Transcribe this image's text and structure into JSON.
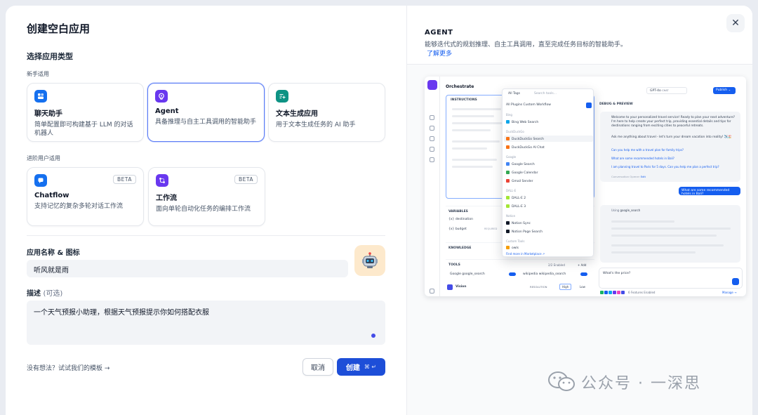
{
  "dialog": {
    "title": "创建空白应用",
    "section_type": "选择应用类型",
    "group_beginner": "新手适用",
    "group_advanced": "进阶用户适用",
    "cards_beginner": [
      {
        "name": "聊天助手",
        "desc": "简单配置即可构建基于 LLM 的对话机器人",
        "color": "#1570ef",
        "icon": "chat-icon"
      },
      {
        "name": "Agent",
        "desc": "具备推理与自主工具调用的智能助手",
        "color": "#6938ef",
        "icon": "agent-icon",
        "selected": true
      },
      {
        "name": "文本生成应用",
        "desc": "用于文本生成任务的 AI 助手",
        "color": "#0e9384",
        "icon": "text-icon"
      }
    ],
    "cards_advanced": [
      {
        "name": "Chatflow",
        "desc": "支持记忆的复杂多轮对话工作流",
        "color": "#1570ef",
        "badge": "BETA",
        "icon": "chatflow-icon"
      },
      {
        "name": "工作流",
        "desc": "面向单轮自动化任务的编排工作流",
        "color": "#6938ef",
        "badge": "BETA",
        "icon": "workflow-icon"
      }
    ],
    "name_label": "应用名称 & 图标",
    "name_value": "听风就是雨",
    "desc_label": "描述",
    "desc_optional": "(可选)",
    "desc_value": "一个天气预报小助理，根据天气预报提示你如何搭配衣服",
    "template_link": "没有想法？试试我们的模板 →",
    "cancel": "取消",
    "create": "创建",
    "create_kbd": "⌘ ↵"
  },
  "preview_panel": {
    "heading": "AGENT",
    "description": "能够迭代式的规划推理、自主工具调用，直至完成任务目标的智能助手。",
    "learn_more": "了解更多",
    "close_icon": "close-icon"
  },
  "screenshot": {
    "orchestrate": "Orchestrate",
    "instructions": "INSTRUCTIONS",
    "variables": "VARIABLES",
    "var1": "{x} destination",
    "var2": "{x} budget",
    "required": "REQUIRED",
    "knowledge": "KNOWLEDGE",
    "tools": "TOOLS",
    "tools_enabled": "2/2 Enabled",
    "add": "+ Add",
    "tool1": "Google  google_search",
    "tool2": "wikipedia  wikipedia_search",
    "vision": "Vision",
    "resolution": "RESOLUTION",
    "high": "High",
    "low": "Low",
    "all_tags": "All Tags",
    "search_tools": "Search tools...",
    "filter_tabs": "All   Plugins   Custom   Workflow",
    "drop_groups": [
      {
        "label": "Bing",
        "items": [
          "Bing Web Search"
        ]
      },
      {
        "label": "DuckDuckGo",
        "items": [
          "DuckDuckGo Search",
          "DuckDuckGo AI Chat"
        ]
      },
      {
        "label": "Google",
        "items": [
          "Google Search",
          "Google Calendar",
          "Gmail Sender"
        ]
      },
      {
        "label": "DALL-E",
        "items": [
          "DALL-E 2",
          "DALL-E 3"
        ]
      },
      {
        "label": "Notion",
        "items": [
          "Notion Sync",
          "Notion Page Search"
        ]
      },
      {
        "label": "Custom Tools",
        "items": [
          "owls"
        ]
      }
    ],
    "find_more": "Find more in Marketplace ↗",
    "debug": "DEBUG & PREVIEW",
    "model": "GPT-4o",
    "model_tag": "CHAT",
    "publish": "Publish ⌄",
    "welcome": "Welcome to your personalized travel service! Ready to plan your next adventure? I'm here to help create your perfect trip, providing essential details and tips for destinations ranging from exciting cities to peaceful retreats.",
    "ask": "Ask me anything about travel - let's turn your dream vacation into reality! ✈️🏖️",
    "sug1": "Can you help me with a travel plan for family trips?",
    "sug2": "What are some recommended hotels in Bali?",
    "sug3": "I am planning travel to Paris for 5 days. Can you help me plan a perfect trip?",
    "opener": "Conversation Opener",
    "edit": "Edit",
    "user_msg": "What are some recommended hotels in Bali?",
    "using": "Using",
    "using_tool": "google_search",
    "input_text": "What's the price?",
    "features": "6 Features Enabled",
    "manage": "Manage →"
  },
  "watermark": "公众号 · 一深思"
}
